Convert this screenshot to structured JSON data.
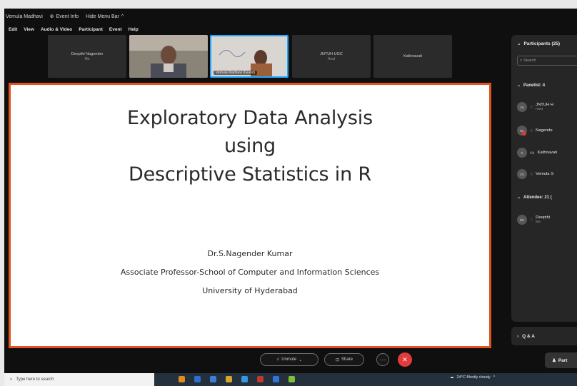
{
  "titlebar": {
    "items": [
      {
        "icon": "window-icon",
        "label": "Vemula Madhavi"
      },
      {
        "icon": "info-icon",
        "label": "Event Info"
      },
      {
        "icon": "",
        "label": "Hide Menu Bar"
      }
    ]
  },
  "menu": [
    "Edit",
    "View",
    "Audio & Video",
    "Participant",
    "Event",
    "Help"
  ],
  "thumbnails": [
    {
      "name": "Deepthi Nagender",
      "sub": "Me",
      "video": false
    },
    {
      "name": "",
      "sub": "",
      "video": true
    },
    {
      "name": "Vemula Madhavi (Guest)",
      "sub": "",
      "video": true,
      "active": true
    },
    {
      "name": "JNTUH UGC",
      "sub": "Host",
      "video": false
    },
    {
      "name": "Kathnavati",
      "sub": "",
      "video": false
    }
  ],
  "slide": {
    "title_lines": [
      "Exploratory Data Analysis",
      "using",
      "Descriptive Statistics in R"
    ],
    "author": "Dr.S.Nagender Kumar",
    "affiliation": "Associate Professor-School of Computer and Information Sciences",
    "university": "University of Hyderabad"
  },
  "panel": {
    "title": "Participants (25)",
    "search_placeholder": "Search",
    "panelist_head": "Panelist: 4",
    "panelists": [
      {
        "initials": "JH",
        "name": "JNTUH H",
        "role": "Host",
        "muted": false,
        "mic": "◌"
      },
      {
        "initials": "NK",
        "name": "Nagende",
        "role": "",
        "muted": true,
        "mic": "◌"
      },
      {
        "initials": "K",
        "name": "Kathnavati",
        "role": "",
        "muted": false,
        "mic": "▭"
      },
      {
        "initials": "VS",
        "name": "Vemula S",
        "role": "",
        "muted": false,
        "mic": "◌"
      }
    ],
    "attendee_head": "Attendee: 21 (",
    "attendees": [
      {
        "initials": "DE",
        "name": "Deepthi",
        "role": "Me",
        "mic": "◌"
      }
    ],
    "qa_label": "Q & A"
  },
  "controls": {
    "unmute": "Unmute",
    "share": "Share",
    "more": "···",
    "leave": "✕",
    "participants": "Part"
  },
  "taskbar": {
    "search_placeholder": "Type here to search",
    "weather": "24°C Mostly cloudy",
    "icons": [
      "#e08a1f",
      "#2b6fd1",
      "#3e7ed6",
      "#d6a62b",
      "#2f9be0",
      "#c0392b",
      "#2b76d6",
      "#7fbf3a"
    ]
  }
}
